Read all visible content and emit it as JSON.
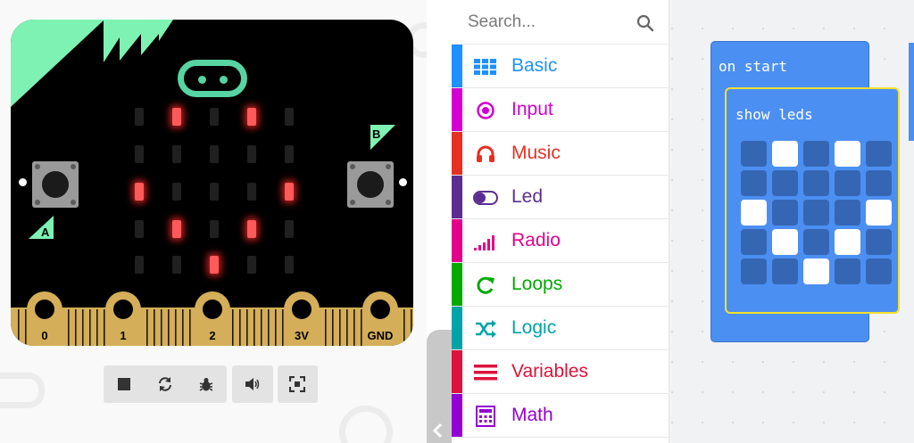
{
  "simulator": {
    "button_a_label": "A",
    "button_b_label": "B",
    "led_grid": [
      [
        0,
        1,
        0,
        1,
        0
      ],
      [
        0,
        0,
        0,
        0,
        0
      ],
      [
        1,
        0,
        0,
        0,
        1
      ],
      [
        0,
        1,
        0,
        1,
        0
      ],
      [
        0,
        0,
        1,
        0,
        0
      ]
    ],
    "pins": [
      "0",
      "1",
      "2",
      "3V",
      "GND"
    ],
    "toolbar": [
      {
        "name": "stop",
        "icon": "stop-icon"
      },
      {
        "name": "restart",
        "icon": "restart-icon"
      },
      {
        "name": "debug",
        "icon": "bug-icon"
      },
      {
        "name": "mute",
        "icon": "speaker-icon"
      },
      {
        "name": "fullscreen",
        "icon": "fullscreen-icon"
      }
    ]
  },
  "toolbox": {
    "search_placeholder": "Search...",
    "categories": [
      {
        "label": "Basic",
        "color": "#1e90ff",
        "icon": "grid-icon"
      },
      {
        "label": "Input",
        "color": "#d400d4",
        "icon": "target-icon"
      },
      {
        "label": "Music",
        "color": "#e63022",
        "icon": "headphones-icon"
      },
      {
        "label": "Led",
        "color": "#5c2d91",
        "icon": "toggle-icon"
      },
      {
        "label": "Radio",
        "color": "#e3008c",
        "icon": "signal-bars-icon"
      },
      {
        "label": "Loops",
        "color": "#00aa00",
        "icon": "loop-arrow-icon"
      },
      {
        "label": "Logic",
        "color": "#00a4a6",
        "icon": "shuffle-icon"
      },
      {
        "label": "Variables",
        "color": "#dc143c",
        "icon": "lines-icon"
      },
      {
        "label": "Math",
        "color": "#9400d3",
        "icon": "calculator-icon"
      }
    ]
  },
  "workspace": {
    "on_start_label": "on start",
    "show_leds_label": "show leds",
    "show_leds_grid": [
      [
        0,
        1,
        0,
        1,
        0
      ],
      [
        0,
        0,
        0,
        0,
        0
      ],
      [
        1,
        0,
        0,
        0,
        1
      ],
      [
        0,
        1,
        0,
        1,
        0
      ],
      [
        0,
        0,
        1,
        0,
        0
      ]
    ]
  }
}
